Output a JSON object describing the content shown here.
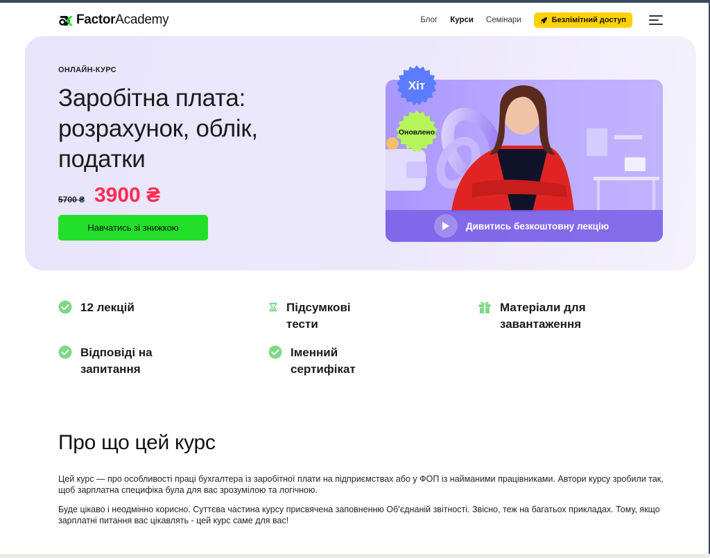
{
  "header": {
    "logo_bold": "Factor",
    "logo_light": "Academy",
    "nav": [
      {
        "label": "Блог",
        "active": false
      },
      {
        "label": "Курси",
        "active": true
      },
      {
        "label": "Семінари",
        "active": false
      }
    ],
    "cta_label": "Безлімітний доступ"
  },
  "hero": {
    "eyebrow": "ОНЛАЙН-КУРС",
    "title_lines": [
      "Заробітна плата:",
      "розрахунок, облік,",
      "податки"
    ],
    "price_old": "5700 ₴",
    "price_new": "3900 ₴",
    "button_label": "Навчатись зі знижкою",
    "badges": {
      "hit": "Хіт",
      "updated": "Оновлено"
    },
    "video_label": "Дивитись безкоштовну лекцію"
  },
  "features": [
    {
      "icon": "check-circle-icon",
      "lines": [
        "12 лекцій"
      ]
    },
    {
      "icon": "hourglass-icon",
      "lines": [
        "Підсумкові",
        "тести"
      ]
    },
    {
      "icon": "gift-icon",
      "lines": [
        "Матеріали для",
        "завантаження"
      ]
    },
    {
      "icon": "check-circle-icon",
      "lines": [
        "Відповіді на",
        "запитання"
      ]
    },
    {
      "icon": "check-circle-icon",
      "lines": [
        "Іменний",
        "сертифікат"
      ]
    }
  ],
  "about": {
    "title": "Про що цей курс",
    "paragraphs": [
      "Цей курс — про особливості праці бухгалтера із заробітної плати на підприємствах або у ФОП із найманими працівниками. Автори курсу зробили так, щоб зарплатна специфіка була для вас зрозумілою та логічною.",
      "Буде цікаво і неодмінно корисно. Суттєва частина курсу присвячена заповненню Об’єднаній звітності. Звісно, теж на багатьох прикладах. Тому, якщо зарплатні питання вас цікавлять - цей курс саме для вас!"
    ]
  },
  "colors": {
    "accent_green": "#22e02a",
    "cta_yellow": "#ffd100",
    "price_red": "#ff2d55",
    "hero_bg": "#ebe7fb",
    "badge_blue": "#5b7cff",
    "badge_lime": "#b6f55a",
    "icon_green": "#7fd88a"
  }
}
